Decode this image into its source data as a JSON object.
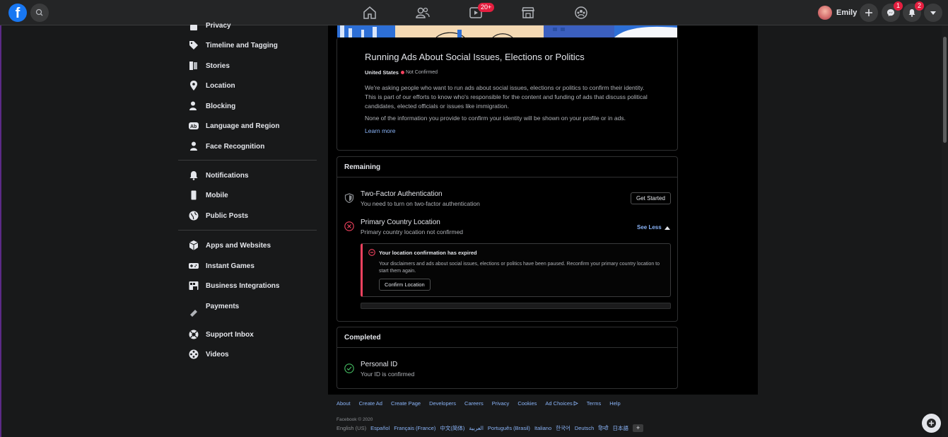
{
  "topbar": {
    "logo": "f",
    "nav_icons": [
      "home-icon",
      "friends-icon",
      "watch-icon",
      "marketplace-icon",
      "groups-icon"
    ],
    "watch_badge": "20+",
    "profile_name": "Emily",
    "messenger_badge": "1",
    "notifications_badge": "2"
  },
  "sidebar": {
    "items": [
      {
        "label": "Privacy",
        "icon": "lock-icon"
      },
      {
        "label": "Timeline and Tagging",
        "icon": "tag-icon"
      },
      {
        "label": "Stories",
        "icon": "book-icon"
      },
      {
        "label": "Location",
        "icon": "location-pin-icon"
      },
      {
        "label": "Blocking",
        "icon": "user-block-icon"
      },
      {
        "label": "Language and Region",
        "icon": "language-icon"
      },
      {
        "label": "Face Recognition",
        "icon": "person-icon"
      },
      {
        "label": "Notifications",
        "icon": "bell-icon"
      },
      {
        "label": "Mobile",
        "icon": "phone-icon"
      },
      {
        "label": "Public Posts",
        "icon": "globe-icon"
      },
      {
        "label": "Apps and Websites",
        "icon": "cube-icon"
      },
      {
        "label": "Instant Games",
        "icon": "gamepad-icon"
      },
      {
        "label": "Business Integrations",
        "icon": "business-icon"
      },
      {
        "label": "Payments",
        "icon": "payment-tag-icon"
      },
      {
        "label": "Support Inbox",
        "icon": "lifebuoy-icon"
      },
      {
        "label": "Videos",
        "icon": "film-icon"
      }
    ]
  },
  "intro_card": {
    "title": "Running Ads About Social Issues, Elections or Politics",
    "country": "United States",
    "status": "Not Confirmed",
    "para1": "We're asking people who want to run ads about social issues, elections or politics to confirm their identity. This is part of our efforts to know who's responsible for the content and funding of ads that discuss political candidates, elected officials or issues like immigration.",
    "para2": "None of the information you provide to confirm your identity will be shown on your profile or in ads.",
    "learn_more": "Learn more"
  },
  "remaining": {
    "header": "Remaining",
    "two_factor_title": "Two-Factor Authentication",
    "two_factor_sub": "You need to turn on two-factor authentication",
    "get_started": "Get Started",
    "country_title": "Primary Country Location",
    "country_sub": "Primary country location not confirmed",
    "see_less": "See Less",
    "alert_title": "Your location confirmation has expired",
    "alert_body": "Your disclaimers and ads about social issues, elections or politics have been paused. Reconfirm your primary country location to start them again.",
    "confirm_location": "Confirm Location"
  },
  "completed": {
    "header": "Completed",
    "personal_id_title": "Personal ID",
    "personal_id_sub": "Your ID is confirmed"
  },
  "footer": {
    "links": [
      "About",
      "Create Ad",
      "Create Page",
      "Developers",
      "Careers",
      "Privacy",
      "Cookies",
      "Ad Choices",
      "Terms",
      "Help"
    ],
    "copyright": "Facebook © 2020",
    "current_lang": "English (US)",
    "languages": [
      "Español",
      "Français (France)",
      "中文(简体)",
      "العربية",
      "Português (Brasil)",
      "Italiano",
      "한국어",
      "Deutsch",
      "हिन्दी",
      "日本語"
    ],
    "more_langs": "+"
  },
  "colors": {
    "accent": "#1877f2",
    "link": "#8ab4f8",
    "error": "#f3425f",
    "success": "#45bd62"
  }
}
